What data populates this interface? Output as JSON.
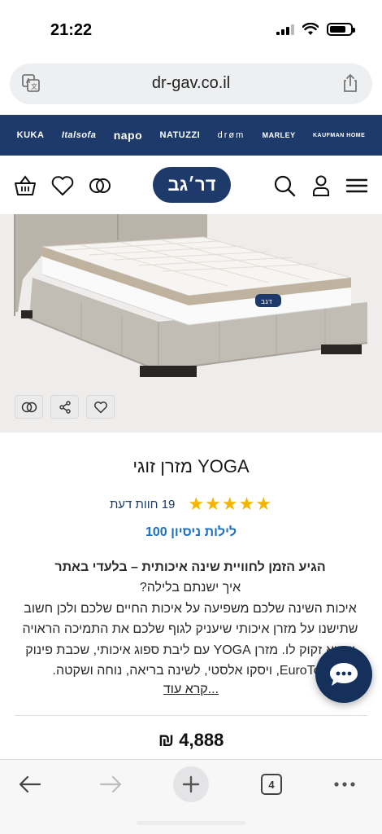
{
  "status_bar": {
    "time": "21:22"
  },
  "browser": {
    "url": "dr-gav.co.il",
    "tabs_count": "4"
  },
  "brands": [
    "KUKA",
    "Italsofa",
    "napo",
    "NATUZZI",
    "drøm",
    "MARLEY",
    "KAUFMAN HOME"
  ],
  "site": {
    "logo_text": "דר׳גב"
  },
  "product": {
    "title": "מזרן זוגי YOGA",
    "rating_stars": 5,
    "reviews": "19 חוות דעת",
    "trial": "100 לילות ניסיון",
    "description": {
      "headline": "הגיע הזמן לחוויית שינה איכותית – בלעדי באתר",
      "question": "איך ישנתם בלילה?",
      "body": "איכות השינה שלכם משפיעה על איכות החיים שלכם ולכן חשוב שתישנו על מזרן איכותי שיעניק לגוף שלכם את התמיכה הראויה שהוא זקוק לו. מזרן YOGA עם ליבת ספוג איכותי, שכבת פינוק EuroTop, ויסקו אלסטי, לשינה בריאה, נוחה ושקטה."
    },
    "read_more": "קרא עוד...",
    "price": "4,888 ₪"
  },
  "colors": {
    "brand_navy": "#1d3a6b",
    "accent_blue": "#1d6fc0",
    "star_gold": "#f5b400",
    "logo_green": "#7ec242"
  }
}
